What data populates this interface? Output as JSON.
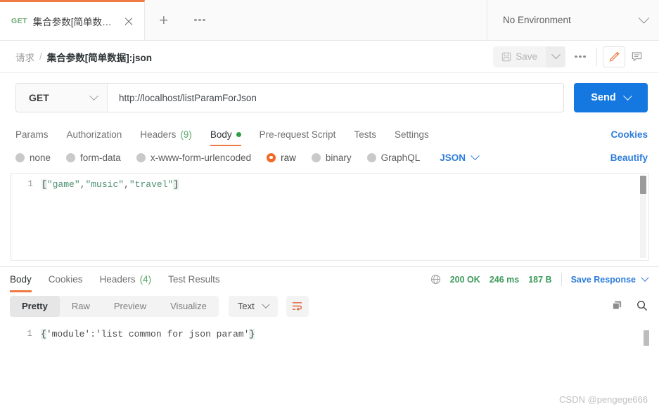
{
  "tab": {
    "method": "GET",
    "title": "集合参数[简单数据]...",
    "close_icon": "close-icon",
    "new_tab_icon": "+",
    "more_icon": "ellipsis-icon"
  },
  "environment": {
    "label": "No Environment"
  },
  "breadcrumb": {
    "root": "请求",
    "separator": "/",
    "current": "集合参数[简单数据]:json"
  },
  "toolbar": {
    "save_label": "Save",
    "save_icon": "floppy-disk-icon",
    "caret_icon": "chevron-down-icon",
    "more_icon": "ellipsis-icon",
    "edit_icon": "pencil-icon",
    "comment_icon": "comment-icon"
  },
  "request": {
    "method": "GET",
    "url": "http://localhost/listParamForJson",
    "send_label": "Send"
  },
  "request_tabs": [
    {
      "label": "Params",
      "count": "",
      "active": false,
      "dot": false
    },
    {
      "label": "Authorization",
      "count": "",
      "active": false,
      "dot": false
    },
    {
      "label": "Headers",
      "count": "(9)",
      "active": false,
      "dot": false
    },
    {
      "label": "Body",
      "count": "",
      "active": true,
      "dot": true
    },
    {
      "label": "Pre-request Script",
      "count": "",
      "active": false,
      "dot": false
    },
    {
      "label": "Tests",
      "count": "",
      "active": false,
      "dot": false
    },
    {
      "label": "Settings",
      "count": "",
      "active": false,
      "dot": false
    }
  ],
  "cookies_link": "Cookies",
  "body_types": [
    {
      "label": "none",
      "selected": false
    },
    {
      "label": "form-data",
      "selected": false
    },
    {
      "label": "x-www-form-urlencoded",
      "selected": false
    },
    {
      "label": "raw",
      "selected": true
    },
    {
      "label": "binary",
      "selected": false
    },
    {
      "label": "GraphQL",
      "selected": false
    }
  ],
  "raw_format": "JSON",
  "beautify_link": "Beautify",
  "editor": {
    "line_number": "1",
    "open_bracket": "[",
    "s1": "\"game\"",
    "c1": ",",
    "s2": "\"music\"",
    "c2": ",",
    "s3": "\"travel\"",
    "close_bracket": "]",
    "full_text": "[\"game\",\"music\",\"travel\"]"
  },
  "response_tabs": [
    {
      "label": "Body",
      "count": "",
      "active": true
    },
    {
      "label": "Cookies",
      "count": "",
      "active": false
    },
    {
      "label": "Headers",
      "count": "(4)",
      "active": false
    },
    {
      "label": "Test Results",
      "count": "",
      "active": false
    }
  ],
  "response_status": {
    "globe_icon": "globe-icon",
    "status": "200 OK",
    "time": "246 ms",
    "size": "187 B",
    "save_response": "Save Response",
    "caret_icon": "chevron-down-icon"
  },
  "format_tabs": [
    {
      "label": "Pretty",
      "selected": true
    },
    {
      "label": "Raw",
      "selected": false
    },
    {
      "label": "Preview",
      "selected": false
    },
    {
      "label": "Visualize",
      "selected": false
    }
  ],
  "response_lang": "Text",
  "wrap_icon": "wrap-lines-icon",
  "copy_icon": "copy-icon",
  "search_icon": "search-icon",
  "response_body": {
    "line_number": "1",
    "open_brace": "{",
    "key": "'module'",
    "colon": ":",
    "value": "'list common for json param'",
    "close_brace": "}",
    "full_text": "{'module':'list common for json param'}"
  },
  "watermark": "CSDN @pengege666",
  "colors": {
    "accent_orange": "#ef7a43",
    "link_blue": "#2f7ddb",
    "send_blue": "#1577e0",
    "success_green": "#3d9a5b",
    "method_green": "#6aaa74",
    "string_green": "#4e8f72"
  }
}
